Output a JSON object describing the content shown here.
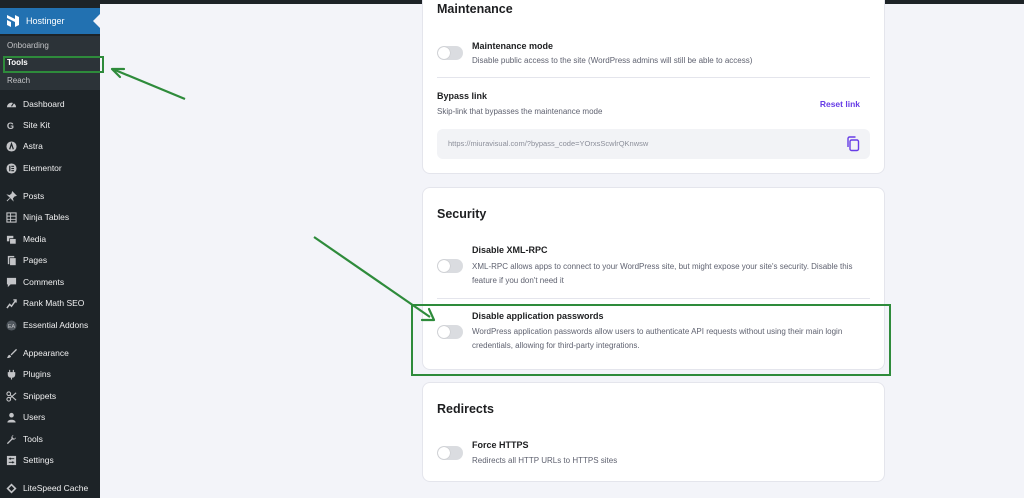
{
  "sidebar": {
    "brand": "Hostinger",
    "submenu": [
      {
        "label": "Onboarding",
        "active": false
      },
      {
        "label": "Tools",
        "active": true
      },
      {
        "label": "Reach",
        "active": false
      }
    ],
    "items": [
      {
        "label": "Dashboard",
        "icon": "dashboard-icon"
      },
      {
        "label": "Site Kit",
        "icon": "site-kit-icon"
      },
      {
        "label": "Astra",
        "icon": "astra-icon"
      },
      {
        "label": "Elementor",
        "icon": "elementor-icon"
      },
      {
        "label": "Posts",
        "icon": "pin-icon"
      },
      {
        "label": "Ninja Tables",
        "icon": "table-icon"
      },
      {
        "label": "Media",
        "icon": "media-icon"
      },
      {
        "label": "Pages",
        "icon": "pages-icon"
      },
      {
        "label": "Comments",
        "icon": "comment-icon"
      },
      {
        "label": "Rank Math SEO",
        "icon": "chart-icon"
      },
      {
        "label": "Essential Addons",
        "icon": "ea-icon"
      },
      {
        "label": "Appearance",
        "icon": "brush-icon"
      },
      {
        "label": "Plugins",
        "icon": "plug-icon"
      },
      {
        "label": "Snippets",
        "icon": "snippets-icon"
      },
      {
        "label": "Users",
        "icon": "user-icon"
      },
      {
        "label": "Tools",
        "icon": "wrench-icon"
      },
      {
        "label": "Settings",
        "icon": "settings-icon"
      },
      {
        "label": "LiteSpeed Cache",
        "icon": "diamond-icon"
      }
    ]
  },
  "maintenance": {
    "title": "Maintenance",
    "mode_title": "Maintenance mode",
    "mode_desc": "Disable public access to the site (WordPress admins will still be able to access)",
    "mode_enabled": false,
    "bypass_title": "Bypass link",
    "bypass_desc": "Skip-link that bypasses the maintenance mode",
    "reset_label": "Reset link",
    "bypass_url": "https://miuravisual.com/?bypass_code=YOrxsScwlrQKnwsw"
  },
  "security": {
    "title": "Security",
    "xmlrpc_title": "Disable XML-RPC",
    "xmlrpc_desc": "XML-RPC allows apps to connect to your WordPress site, but might expose your site's security. Disable this feature if you don't need it",
    "xmlrpc_enabled": false,
    "apppw_title": "Disable application passwords",
    "apppw_desc": "WordPress application passwords allow users to authenticate API requests without using their main login credentials, allowing for third-party integrations.",
    "apppw_enabled": false
  },
  "redirects": {
    "title": "Redirects",
    "https_title": "Force HTTPS",
    "https_desc": "Redirects all HTTP URLs to HTTPS sites",
    "https_enabled": false
  },
  "colors": {
    "sidebar_bg": "#1d2327",
    "accent_blue": "#2271b1",
    "link_purple": "#673de6",
    "annotation_green": "#2e8b3b"
  }
}
